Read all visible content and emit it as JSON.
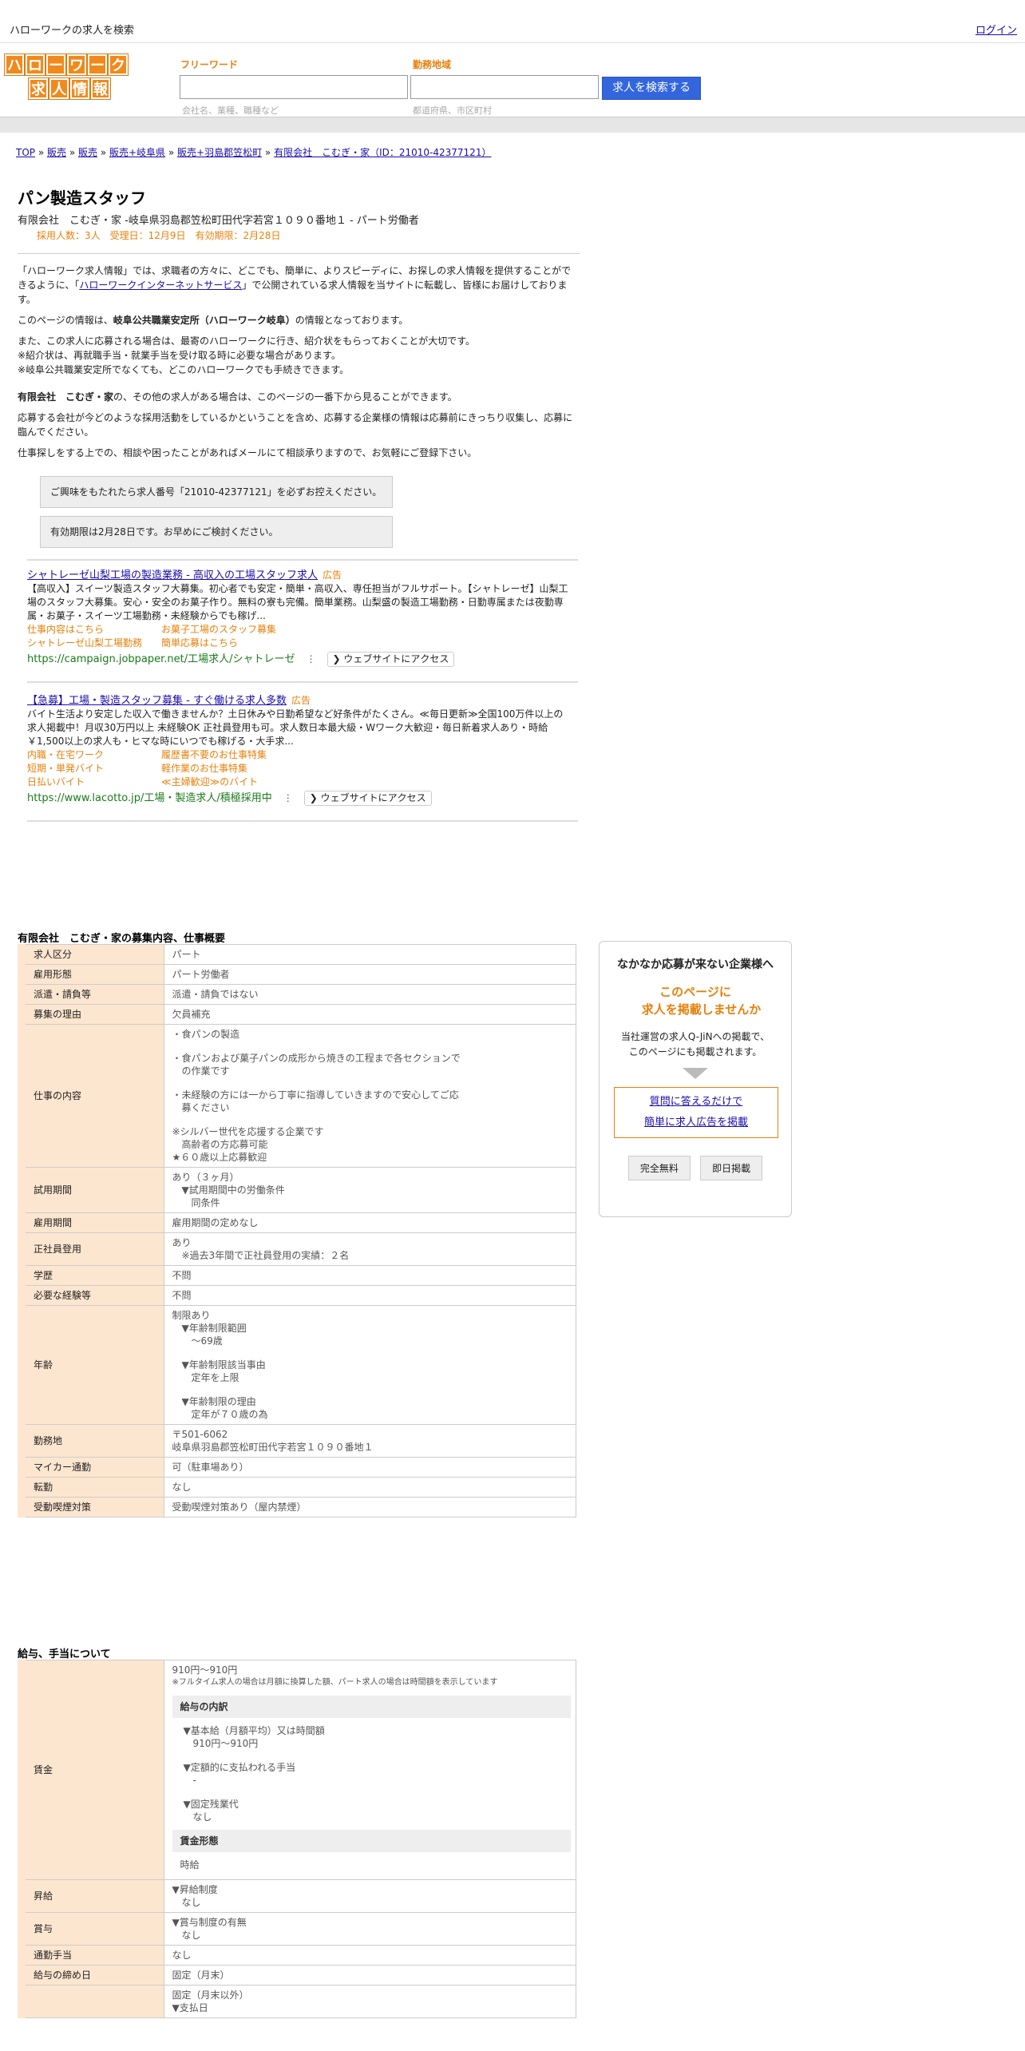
{
  "top": {
    "title": "ハローワークの求人を検索",
    "login": "ログイン"
  },
  "logo": {
    "row1": [
      "ハ",
      "ロ",
      "ー",
      "ワ",
      "ー",
      "ク"
    ],
    "row2": [
      "求",
      "人",
      "情",
      "報"
    ]
  },
  "search": {
    "freeword_label": "フリーワード",
    "freeword_placeholder": "会社名、業種、職種など",
    "area_label": "勤務地域",
    "area_placeholder": "都道府県、市区町村",
    "button": "求人を検索する"
  },
  "breadcrumb": {
    "items": [
      "TOP",
      "販売",
      "販売",
      "販売+岐阜県",
      "販売+羽島郡笠松町",
      "有限会社　こむぎ・家（ID：21010-42377121）"
    ],
    "sep": "»"
  },
  "job": {
    "title": "パン製造スタッフ",
    "subtitle": "有限会社　こむぎ・家 -岐阜県羽島郡笠松町田代字若宮１０９０番地１ - パート労働者",
    "meta": "採用人数：3人　受理日：12月9日　有効期限：2月28日"
  },
  "intro": {
    "p1a": "「ハローワーク求人情報」では、求職者の方々に、どこでも、簡単に、よりスピーディに、お探しの求人情報を提供することができるように、「",
    "p1link": "ハローワークインターネットサービス",
    "p1b": "」で公開されている求人情報を当サイトに転載し、皆様にお届けしております。",
    "p2a": "このページの情報は、",
    "p2b": "岐阜公共職業安定所（ハローワーク岐阜）",
    "p2c": "の情報となっております。",
    "p3": "また、この求人に応募される場合は、最寄のハローワークに行き、紹介状をもらっておくことが大切です。",
    "p3b": "※紹介状は、再就職手当・就業手当を受け取る時に必要な場合があります。",
    "p3c": "※岐阜公共職業安定所でなくても、どこのハローワークでも手続きできます。",
    "p4a": "有限会社　こむぎ・家",
    "p4b": "の、その他の求人がある場合は、このページの一番下から見ることができます。",
    "p5": "応募する会社が今どのような採用活動をしているかということを含め、応募する企業様の情報は応募前にきっちり収集し、応募に臨んでください。",
    "p6": "仕事探しをする上での、相談や困ったことがあればメールにて相談承りますので、お気軽にご登録下さい。"
  },
  "notices": [
    "ご興味をもたれたら求人番号「21010-42377121」を必ずお控えください。",
    "有効期限は2月28日です。お早めにご検討ください。"
  ],
  "ads": [
    {
      "headline": "シャトレーゼ山梨工場の製造業務 - 高収入の工場スタッフ求人",
      "tag": "広告",
      "desc": "【高収入】スイーツ製造スタッフ大募集。初心者でも安定・簡単・高収入、専任担当がフルサポート。【シャトレーゼ】山梨工場のスタッフ大募集。安心・安全のお菓子作り。無料の寮も完備。簡単業務。山梨盛の製造工場勤務・日勤専属または夜勤専属・お菓子・スイーツ工場勤務・未経験からでも稼げ...",
      "sitelinks": [
        [
          "仕事内容はこちら",
          "お菓子工場のスタッフ募集"
        ],
        [
          "シャトレーゼ山梨工場勤務",
          "簡単応募はこちら"
        ]
      ],
      "url": "https://campaign.jobpaper.net/工場求人/シャトレーゼ",
      "visit": "❯ ウェブサイトにアクセス"
    },
    {
      "headline": "【急募】工場・製造スタッフ募集 - すぐ働ける求人多数",
      "tag": "広告",
      "desc": "バイト生活より安定した収入で働きませんか？土日休みや日勤希望など好条件がたくさん。≪毎日更新≫全国100万件以上の求人掲載中！月収30万円以上 未経験OK 正社員登用も可。求人数日本最大級・Wワーク大歓迎・毎日新着求人あり・時給￥1,500以上の求人も・ヒマな時にいつでも稼げる・大手求...",
      "sitelinks": [
        [
          "内職・在宅ワーク",
          "履歴書不要のお仕事特集"
        ],
        [
          "短期・単発バイト",
          "軽作業のお仕事特集"
        ],
        [
          "日払いバイト",
          "≪主婦歓迎≫のバイト"
        ]
      ],
      "url": "https://www.lacotto.jp/工場・製造求人/積極採用中",
      "visit": "❯ ウェブサイトにアクセス"
    }
  ],
  "section1": "有限会社　こむぎ・家の募集内容、仕事概要",
  "table1": [
    {
      "k": "求人区分",
      "v": [
        "パート"
      ]
    },
    {
      "k": "雇用形態",
      "v": [
        "パート労働者"
      ]
    },
    {
      "k": "派遣・請負等",
      "v": [
        "派遣・請負ではない"
      ]
    },
    {
      "k": "募集の理由",
      "v": [
        "欠員補充"
      ]
    },
    {
      "k": "仕事の内容",
      "v": [
        "・食パンの製造",
        "",
        "・食パンおよび菓子パンの成形から焼きの工程まで各セクションで",
        "　の作業です",
        "",
        "・未経験の方には一から丁寧に指導していきますので安心してご応",
        "　募ください",
        "",
        "※シルバー世代を応援する企業です",
        "　高齢者の方応募可能",
        "★６０歳以上応募歓迎"
      ]
    },
    {
      "k": "試用期間",
      "v": [
        "あり（３ヶ月）",
        "　▼試用期間中の労働条件",
        "　　同条件"
      ]
    },
    {
      "k": "雇用期間",
      "v": [
        "雇用期間の定めなし"
      ]
    },
    {
      "k": "正社員登用",
      "v": [
        "あり",
        "　※過去3年間で正社員登用の実績：２名"
      ]
    },
    {
      "k": "学歴",
      "v": [
        "不問"
      ]
    },
    {
      "k": "必要な経験等",
      "v": [
        "不問"
      ]
    },
    {
      "k": "年齢",
      "v": [
        "制限あり",
        "　▼年齢制限範囲",
        "　　〜69歳",
        "",
        "　▼年齢制限該当事由",
        "　　定年を上限",
        "",
        "　▼年齢制限の理由",
        "　　定年が７０歳の為"
      ]
    },
    {
      "k": "勤務地",
      "v": [
        "〒501-6062",
        "岐阜県羽島郡笠松町田代字若宮１０９０番地１"
      ]
    },
    {
      "k": "マイカー通勤",
      "v": [
        "可（駐車場あり）"
      ]
    },
    {
      "k": "転勤",
      "v": [
        "なし"
      ]
    },
    {
      "k": "受動喫煙対策",
      "v": [
        "受動喫煙対策あり（屋内禁煙）"
      ]
    }
  ],
  "section2": "給与、手当について",
  "wage": {
    "k": "賃金",
    "range": "910円〜910円",
    "note": "※フルタイム求人の場合は月額に換算した額、パート求人の場合は時間額を表示しています",
    "breakdown_title": "給与の内訳",
    "breakdown": [
      "▼基本給（月額平均）又は時間額",
      "　910円〜910円",
      "",
      "▼定額的に支払われる手当",
      "　-",
      "",
      "▼固定残業代",
      "　なし"
    ],
    "form_title": "賃金形態",
    "form": "時給"
  },
  "table2": [
    {
      "k": "昇給",
      "v": [
        "▼昇給制度",
        "　なし"
      ]
    },
    {
      "k": "賞与",
      "v": [
        "▼賞与制度の有無",
        "　なし"
      ]
    },
    {
      "k": "通勤手当",
      "v": [
        "なし"
      ]
    },
    {
      "k": "給与の締め日",
      "v": [
        "固定（月末）"
      ]
    },
    {
      "k": "",
      "v": [
        "固定（月末以外）",
        "▼支払日"
      ]
    }
  ],
  "side": {
    "title": "なかなか応募が来ない企業様へ",
    "orange1": "このページに",
    "orange2": "　求人を掲載しませんか",
    "text1": "当社運営の求人Q-JiNへの掲載で、",
    "text2": "このページにも掲載されます。",
    "link1": "質問に答えるだけで",
    "link2": "簡単に求人広告を掲載",
    "btn1": "完全無料",
    "btn2": "即日掲載"
  }
}
